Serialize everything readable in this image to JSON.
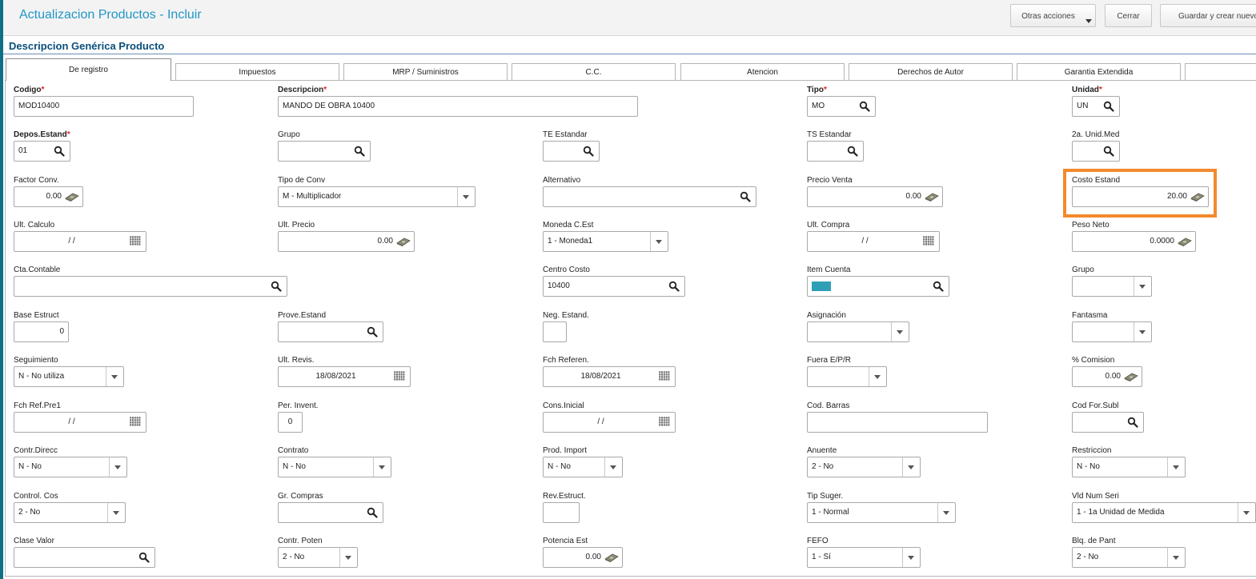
{
  "header": {
    "title": "Actualizacion Productos - Incluir",
    "buttons": {
      "otras_acciones": "Otras acciones",
      "cerrar": "Cerrar",
      "guardar": "Guardar y crear nuevo"
    }
  },
  "section_title": "Descripcion Genérica Producto",
  "tabs": [
    "De registro",
    "Impuestos",
    "MRP / Suministros",
    "C.C.",
    "Atencion",
    "Derechos de Autor",
    "Garantia Extendida",
    ""
  ],
  "active_tab": "De registro",
  "required_marker": "*",
  "fields": [
    {
      "label": "Codigo",
      "value": "MOD10400",
      "required": true
    },
    {
      "label": "Descripcion",
      "value": "MANDO DE OBRA 10400",
      "required": true
    },
    {
      "label": "Tipo",
      "value": "MO",
      "required": true,
      "icon": "search-icon"
    },
    {
      "label": "Unidad",
      "value": "UN",
      "required": true,
      "icon": "search-icon"
    },
    {
      "label": "Depos.Estand",
      "value": "01",
      "required": true,
      "icon": "search-icon"
    },
    {
      "label": "Grupo",
      "value": "",
      "icon": "search-icon"
    },
    {
      "label": "TE Estandar",
      "value": "",
      "icon": "search-icon"
    },
    {
      "label": "TS Estandar",
      "value": "",
      "icon": "search-icon"
    },
    {
      "label": "2a. Unid.Med",
      "value": "",
      "icon": "search-icon"
    },
    {
      "label": "Factor Conv.",
      "value": "0.00",
      "icon": "money-icon"
    },
    {
      "label": "Tipo de Conv",
      "value": "M - Multiplicador",
      "icon": "dropdown"
    },
    {
      "label": "Alternativo",
      "value": "",
      "icon": "search-icon"
    },
    {
      "label": "Precio Venta",
      "value": "0.00",
      "icon": "money-icon"
    },
    {
      "label": "Costo Estand",
      "value": "20.00",
      "icon": "money-icon",
      "highlighted": true
    },
    {
      "label": "Ult. Calculo",
      "value": "/ /",
      "icon": "calendar-icon"
    },
    {
      "label": "Ult. Precio",
      "value": "0.00",
      "icon": "money-icon"
    },
    {
      "label": "Moneda C.Est",
      "value": "1 - Moneda1",
      "icon": "dropdown"
    },
    {
      "label": "Ult. Compra",
      "value": "/ /",
      "icon": "calendar-icon"
    },
    {
      "label": "Peso Neto",
      "value": "0.0000",
      "icon": "money-icon"
    },
    {
      "label": "Cta.Contable",
      "value": "",
      "icon": "search-icon"
    },
    {
      "label": "Centro Costo",
      "value": "10400",
      "icon": "search-icon"
    },
    {
      "label": "Item Cuenta",
      "value": "",
      "icon": "search-icon",
      "chip_color": "#2f9fb6"
    },
    {
      "label": "Grupo",
      "value": "",
      "icon": "dropdown"
    },
    {
      "label": "Base Estruct",
      "value": "0"
    },
    {
      "label": "Prove.Estand",
      "value": "",
      "icon": "search-icon"
    },
    {
      "label": "Neg. Estand.",
      "value": ""
    },
    {
      "label": "Asignación",
      "value": "",
      "icon": "dropdown"
    },
    {
      "label": "Fantasma",
      "value": "",
      "icon": "dropdown"
    },
    {
      "label": "Seguimiento",
      "value": "N - No utiliza",
      "icon": "dropdown"
    },
    {
      "label": "Ult. Revis.",
      "value": "18/08/2021",
      "icon": "calendar-icon"
    },
    {
      "label": "Fch Referen.",
      "value": "18/08/2021",
      "icon": "calendar-icon"
    },
    {
      "label": "Fuera E/P/R",
      "value": "",
      "icon": "dropdown"
    },
    {
      "label": "% Comision",
      "value": "0.00",
      "icon": "money-icon"
    },
    {
      "label": "Fch Ref.Pre1",
      "value": "/ /",
      "icon": "calendar-icon"
    },
    {
      "label": "Per. Invent.",
      "value": "0"
    },
    {
      "label": "Cons.Inicial",
      "value": "/ /",
      "icon": "calendar-icon"
    },
    {
      "label": "Cod. Barras",
      "value": ""
    },
    {
      "label": "Cod For.Subl",
      "value": "",
      "icon": "search-icon"
    },
    {
      "label": "Contr.Direcc",
      "value": "N - No",
      "icon": "dropdown"
    },
    {
      "label": "Contrato",
      "value": "N - No",
      "icon": "dropdown"
    },
    {
      "label": "Prod. Import",
      "value": "N - No",
      "icon": "dropdown"
    },
    {
      "label": "Anuente",
      "value": "2 - No",
      "icon": "dropdown"
    },
    {
      "label": "Restriccion",
      "value": "N - No",
      "icon": "dropdown"
    },
    {
      "label": "Control. Cos",
      "value": "2 - No",
      "icon": "dropdown"
    },
    {
      "label": "Gr. Compras",
      "value": "",
      "icon": "search-icon"
    },
    {
      "label": "Rev.Estruct.",
      "value": ""
    },
    {
      "label": "Tip Suger.",
      "value": "1 - Normal",
      "icon": "dropdown"
    },
    {
      "label": "Vld Num Seri",
      "value": "1 - 1a Unidad de Medida",
      "icon": "dropdown"
    },
    {
      "label": "Clase Valor",
      "value": "",
      "icon": "search-icon"
    },
    {
      "label": "Contr. Poten",
      "value": "2 - No",
      "icon": "dropdown"
    },
    {
      "label": "Potencia Est",
      "value": "0.00",
      "icon": "money-icon"
    },
    {
      "label": "FEFO",
      "value": "1 - Sí",
      "icon": "dropdown"
    },
    {
      "label": "Blq. de Pant",
      "value": "2 - No",
      "icon": "dropdown"
    }
  ]
}
